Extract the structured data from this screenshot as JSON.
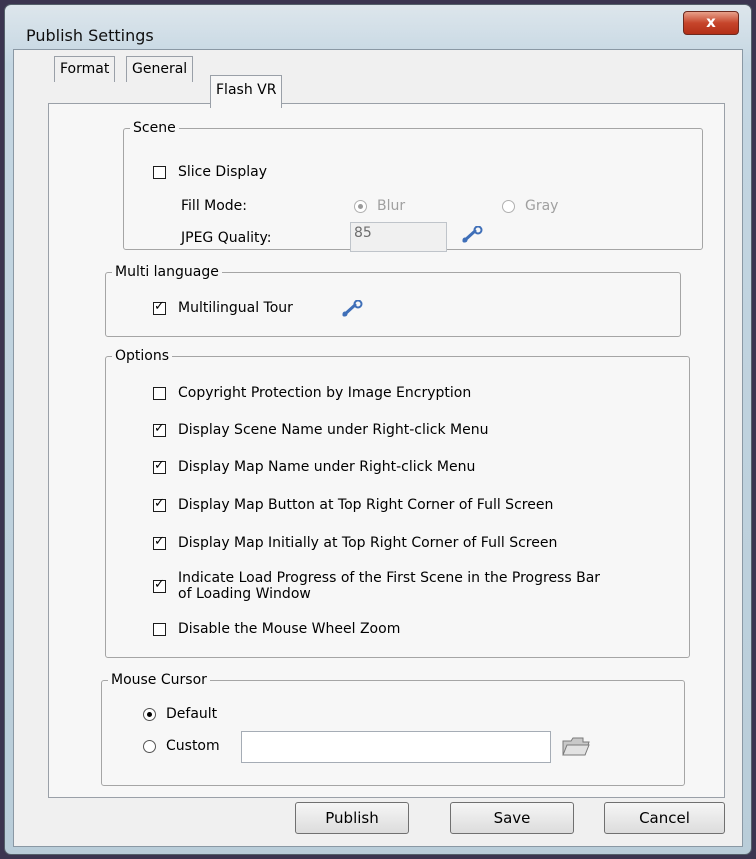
{
  "window": {
    "title": "Publish Settings",
    "close_label": "x"
  },
  "tabs": [
    {
      "label": "Format"
    },
    {
      "label": "General"
    },
    {
      "label": "Flash VR"
    }
  ],
  "scene": {
    "legend": "Scene",
    "slice_display": {
      "label": "Slice Display",
      "checked": false
    },
    "fill_mode": {
      "label": "Fill Mode:",
      "options": [
        "Blur",
        "Gray"
      ],
      "selected": "Blur",
      "enabled": false
    },
    "jpeg_quality": {
      "label": "JPEG Quality:",
      "value": "85",
      "enabled": false
    }
  },
  "multi_language": {
    "legend": "Multi language",
    "multilingual_tour": {
      "label": "Multilingual Tour",
      "checked": true
    }
  },
  "options": {
    "legend": "Options",
    "items": [
      {
        "label": "Copyright Protection by Image Encryption",
        "checked": false
      },
      {
        "label": "Display Scene Name under Right-click Menu",
        "checked": true
      },
      {
        "label": "Display Map Name under Right-click Menu",
        "checked": true
      },
      {
        "label": "Display Map Button at Top Right Corner of Full Screen",
        "checked": true
      },
      {
        "label": "Display Map Initially at Top Right Corner of Full Screen",
        "checked": true
      },
      {
        "label_line1": "Indicate Load Progress of the First Scene in the Progress Bar",
        "label_line2": "of Loading Window",
        "checked": true
      },
      {
        "label": "Disable the Mouse Wheel Zoom",
        "checked": false
      }
    ]
  },
  "mouse_cursor": {
    "legend": "Mouse Cursor",
    "default_label": "Default",
    "custom_label": "Custom",
    "selected": "Default",
    "custom_path": ""
  },
  "buttons": {
    "publish": "Publish",
    "save": "Save",
    "cancel": "Cancel"
  },
  "colors": {
    "accent_blue": "#3f6fb8",
    "close_red": "#c6452b"
  },
  "icons": {
    "settings": "wrench-icon",
    "browse": "folder-icon"
  }
}
